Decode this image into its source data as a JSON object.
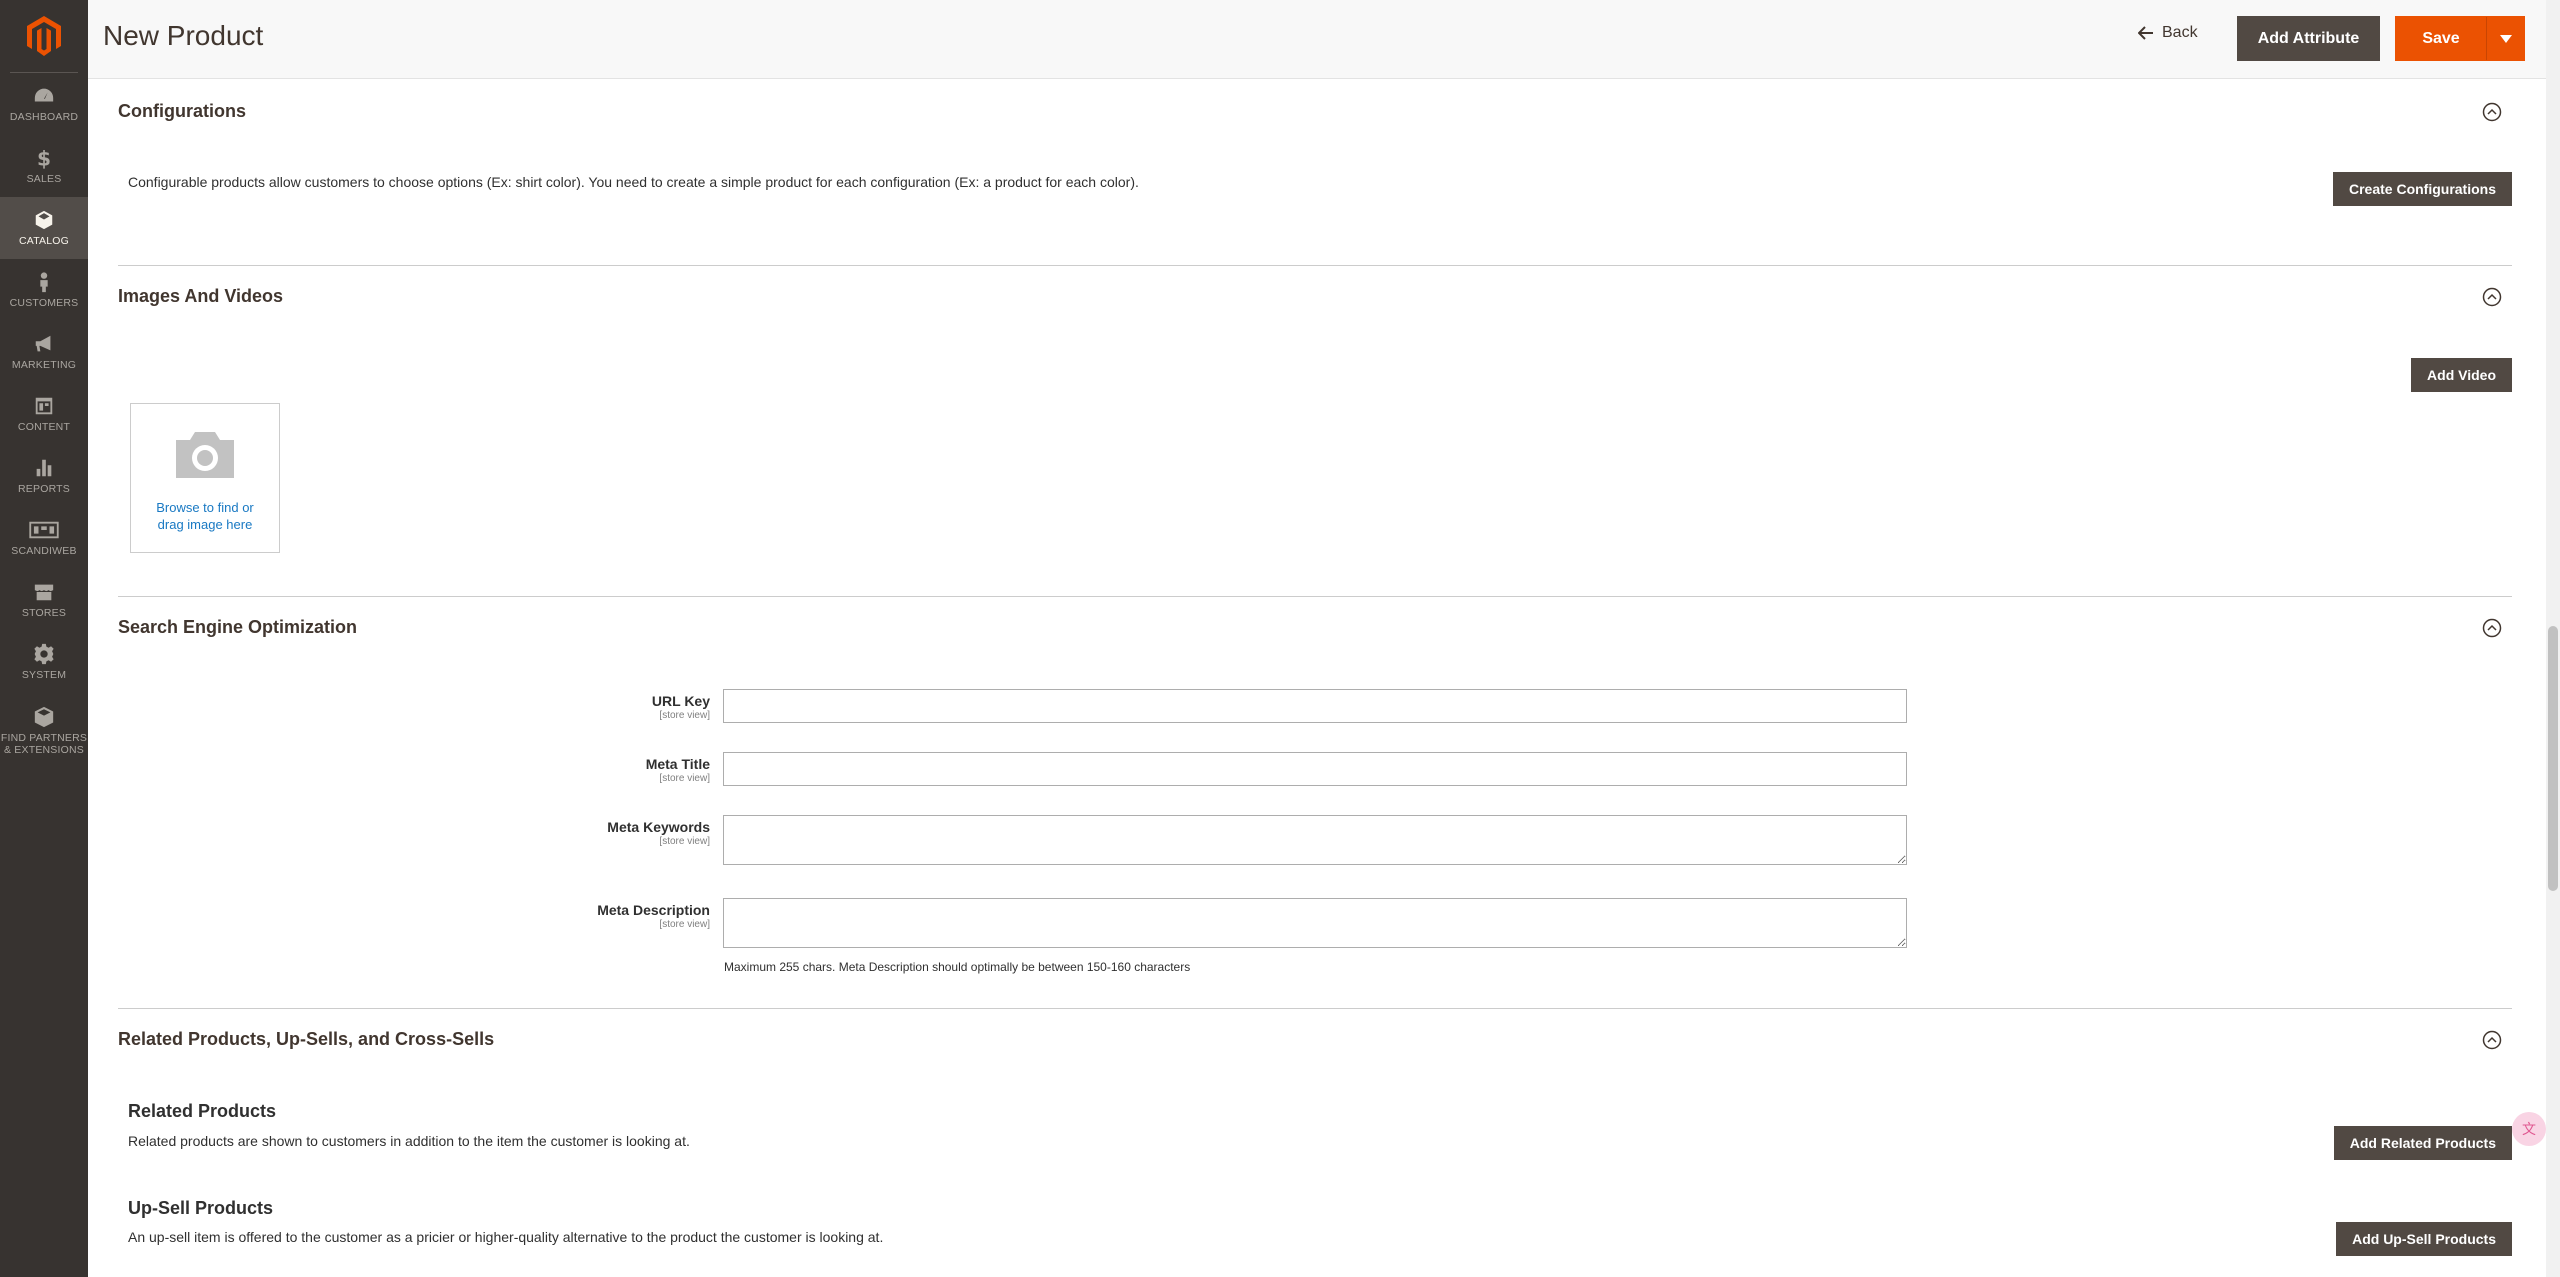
{
  "sidebar": {
    "items": [
      {
        "label": "Dashboard",
        "icon": "dashboard-icon"
      },
      {
        "label": "Sales",
        "icon": "dollar-icon"
      },
      {
        "label": "Catalog",
        "icon": "box-icon",
        "active": true
      },
      {
        "label": "Customers",
        "icon": "person-icon"
      },
      {
        "label": "Marketing",
        "icon": "megaphone-icon"
      },
      {
        "label": "Content",
        "icon": "layout-icon"
      },
      {
        "label": "Reports",
        "icon": "bar-chart-icon"
      },
      {
        "label": "Scandiweb",
        "icon": "scandiweb-icon"
      },
      {
        "label": "Stores",
        "icon": "store-icon"
      },
      {
        "label": "System",
        "icon": "gear-icon"
      },
      {
        "label": "Find Partners & Extensions",
        "icon": "cube-icon"
      }
    ]
  },
  "header": {
    "title": "New Product",
    "back_label": "Back",
    "add_attribute_label": "Add Attribute",
    "save_label": "Save"
  },
  "configurations": {
    "title": "Configurations",
    "description": "Configurable products allow customers to choose options (Ex: shirt color). You need to create a simple product for each configuration (Ex: a product for each color).",
    "button_label": "Create Configurations"
  },
  "images": {
    "title": "Images And Videos",
    "add_video_label": "Add Video",
    "drop_line1": "Browse to find or",
    "drop_line2": "drag image here"
  },
  "seo": {
    "title": "Search Engine Optimization",
    "scope": "[store view]",
    "url_key_label": "URL Key",
    "url_key_value": "",
    "meta_title_label": "Meta Title",
    "meta_title_value": "",
    "meta_keywords_label": "Meta Keywords",
    "meta_keywords_value": "",
    "meta_description_label": "Meta Description",
    "meta_description_value": "",
    "meta_description_note": "Maximum 255 chars. Meta Description should optimally be between 150-160 characters"
  },
  "related": {
    "title": "Related Products, Up-Sells, and Cross-Sells",
    "related_title": "Related Products",
    "related_desc": "Related products are shown to customers in addition to the item the customer is looking at.",
    "related_button": "Add Related Products",
    "upsell_title": "Up-Sell Products",
    "upsell_desc": "An up-sell item is offered to the customer as a pricier or higher-quality alternative to the product the customer is looking at.",
    "upsell_button": "Add Up-Sell Products"
  },
  "colors": {
    "accent": "#eb5202",
    "sidebar_bg": "#373330",
    "dark_button": "#514943",
    "link": "#1979c3"
  }
}
